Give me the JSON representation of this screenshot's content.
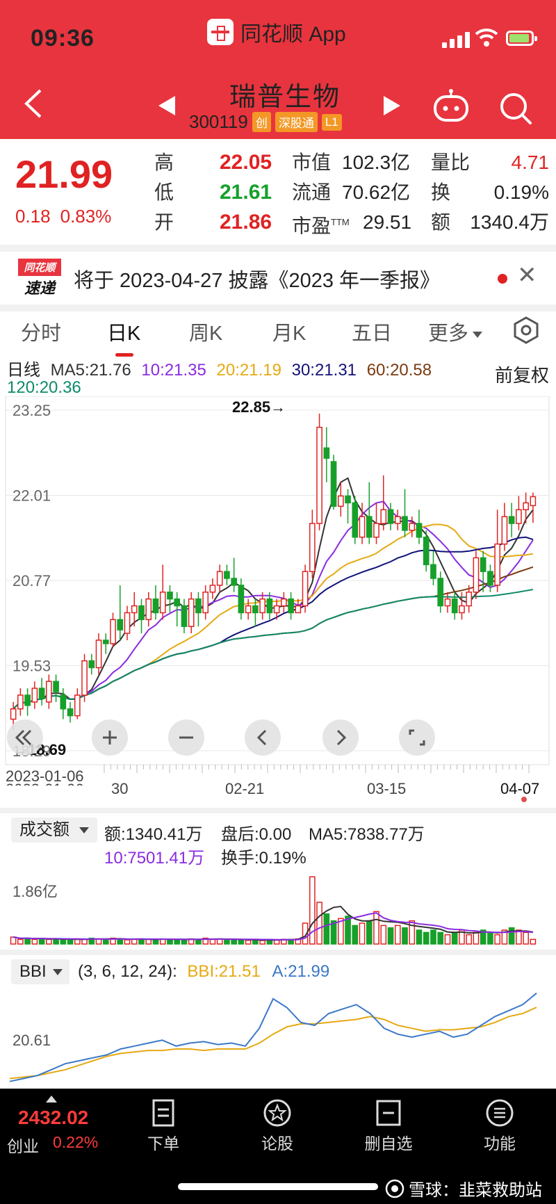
{
  "status_bar": {
    "time": "09:36",
    "app_name": "同花顺 App"
  },
  "header": {
    "stock_name": "瑞普生物",
    "stock_code": "300119",
    "tags": [
      "创",
      "深股通",
      "L1"
    ]
  },
  "quote": {
    "price": "21.99",
    "change": "0.18",
    "change_pct": "0.83%",
    "rows": [
      {
        "l1": "高",
        "v1": "22.05",
        "l2": "市值",
        "v2": "102.3亿",
        "l3": "量比",
        "v3": "4.71"
      },
      {
        "l1": "低",
        "v1": "21.61",
        "l2": "流通",
        "v2": "70.62亿",
        "l3": "换",
        "v3": "0.19%"
      },
      {
        "l1": "开",
        "v1": "21.86",
        "l2": "市盈",
        "l2_sup": "TTM",
        "v2": "29.51",
        "l3": "额",
        "v3": "1340.4万"
      }
    ]
  },
  "notice": {
    "logo_top": "同花顺",
    "logo_bottom": "速递",
    "text": "将于 2023-04-27 披露《2023 年一季报》"
  },
  "tabs": [
    "分时",
    "日K",
    "周K",
    "月K",
    "五日",
    "更多"
  ],
  "ma_legend": {
    "label": "日线",
    "ma5": "MA5:21.76",
    "ma10": "10:21.35",
    "ma20": "20:21.19",
    "ma30": "30:21.31",
    "ma60": "60:20.58",
    "ma120": "120:20.36",
    "adjust": "前复权"
  },
  "kchart": {
    "y_ticks": [
      "23.25",
      "22.01",
      "20.77",
      "19.53",
      "18.29"
    ],
    "high_mark": "22.85→",
    "low_mark": "←18.69",
    "x_labels": [
      "2023-01-06",
      "30",
      "02-21",
      "03-15",
      "04-07"
    ]
  },
  "volume": {
    "indicator": "成交额",
    "amount": "额:1340.41万",
    "after": "盘后:0.00",
    "ma5": "MA5:7838.77万",
    "ma10": "10:7501.41万",
    "turnover": "换手:0.19%",
    "y_tick": "1.86亿"
  },
  "bbi": {
    "indicator": "BBI",
    "params": "(3, 6, 12, 24):",
    "bbi_val": "BBI:21.51",
    "a_val": "A:21.99",
    "y_tick": "20.61"
  },
  "bottom_nav": {
    "index_value": "2432.02",
    "index_name": "创业",
    "index_change": "0.22%",
    "items": [
      "下单",
      "论股",
      "删自选",
      "功能"
    ]
  },
  "watermark": "雪球：韭菜救助站",
  "colors": {
    "header_red": "#e8343e",
    "up": "#e02222",
    "down": "#16a02a",
    "ma5": "#333333",
    "ma10": "#8a2be2",
    "ma20": "#e5a912",
    "ma30": "#12127a",
    "ma60": "#7b3a10",
    "ma120": "#0f8a6a",
    "bbi": "#e5a912",
    "bbi_a": "#3b78c8"
  },
  "chart_data": {
    "type": "candlestick",
    "ylim": [
      18.29,
      23.25
    ],
    "candles": [
      [
        18.75,
        18.9,
        18.6,
        19.0
      ],
      [
        18.9,
        19.1,
        18.8,
        19.2
      ],
      [
        19.1,
        18.95,
        18.8,
        19.2
      ],
      [
        19.0,
        19.2,
        18.9,
        19.3
      ],
      [
        19.2,
        19.05,
        18.95,
        19.35
      ],
      [
        19.0,
        19.3,
        18.9,
        19.4
      ],
      [
        19.3,
        19.15,
        19.0,
        19.4
      ],
      [
        19.1,
        18.9,
        18.75,
        19.2
      ],
      [
        18.9,
        18.8,
        18.7,
        19.0
      ],
      [
        18.8,
        19.1,
        18.75,
        19.2
      ],
      [
        19.1,
        19.6,
        19.0,
        19.7
      ],
      [
        19.6,
        19.5,
        19.4,
        19.7
      ],
      [
        19.5,
        19.9,
        19.4,
        20.0
      ],
      [
        19.9,
        19.85,
        19.7,
        20.0
      ],
      [
        19.85,
        20.2,
        19.8,
        20.3
      ],
      [
        20.2,
        20.05,
        19.9,
        20.7
      ],
      [
        20.0,
        20.3,
        19.9,
        20.4
      ],
      [
        20.3,
        20.4,
        20.1,
        20.6
      ],
      [
        20.4,
        20.2,
        20.0,
        20.5
      ],
      [
        20.2,
        20.5,
        20.1,
        20.6
      ],
      [
        20.5,
        20.3,
        20.2,
        20.7
      ],
      [
        20.3,
        20.6,
        20.2,
        21.0
      ],
      [
        20.6,
        20.5,
        20.3,
        20.7
      ],
      [
        20.5,
        20.4,
        20.1,
        20.6
      ],
      [
        20.4,
        20.1,
        20.0,
        20.5
      ],
      [
        20.1,
        20.5,
        20.0,
        20.6
      ],
      [
        20.5,
        20.3,
        20.1,
        20.6
      ],
      [
        20.3,
        20.6,
        20.2,
        20.7
      ],
      [
        20.6,
        20.7,
        20.5,
        20.8
      ],
      [
        20.7,
        20.9,
        20.6,
        21.0
      ],
      [
        20.9,
        20.8,
        20.7,
        21.0
      ],
      [
        20.8,
        20.7,
        20.6,
        21.1
      ],
      [
        20.7,
        20.3,
        20.2,
        20.8
      ],
      [
        20.3,
        20.4,
        20.2,
        20.5
      ],
      [
        20.4,
        20.3,
        20.1,
        20.5
      ],
      [
        20.3,
        20.5,
        20.2,
        20.6
      ],
      [
        20.5,
        20.3,
        20.2,
        20.6
      ],
      [
        20.3,
        20.4,
        20.2,
        20.5
      ],
      [
        20.4,
        20.5,
        20.3,
        20.6
      ],
      [
        20.5,
        20.3,
        20.2,
        20.6
      ],
      [
        20.3,
        20.4,
        20.3,
        20.5
      ],
      [
        20.4,
        20.9,
        20.3,
        21.0
      ],
      [
        20.9,
        21.6,
        20.8,
        21.8
      ],
      [
        21.6,
        23.0,
        21.5,
        23.2
      ],
      [
        22.7,
        22.55,
        22.2,
        23.0
      ],
      [
        22.5,
        21.85,
        21.8,
        22.6
      ],
      [
        21.85,
        22.0,
        21.7,
        22.2
      ],
      [
        22.0,
        21.9,
        21.6,
        22.1
      ],
      [
        21.9,
        21.4,
        21.3,
        22.0
      ],
      [
        21.4,
        21.7,
        21.3,
        21.9
      ],
      [
        21.7,
        21.4,
        21.3,
        22.2
      ],
      [
        21.4,
        21.6,
        21.3,
        21.9
      ],
      [
        21.6,
        21.8,
        21.5,
        22.3
      ],
      [
        21.8,
        21.6,
        21.5,
        21.9
      ],
      [
        21.6,
        21.7,
        21.5,
        21.8
      ],
      [
        21.7,
        21.5,
        21.4,
        22.1
      ],
      [
        21.5,
        21.6,
        21.4,
        21.7
      ],
      [
        21.6,
        21.4,
        21.3,
        21.8
      ],
      [
        21.4,
        21.0,
        20.9,
        21.5
      ],
      [
        21.0,
        20.8,
        20.7,
        21.2
      ],
      [
        20.8,
        20.4,
        20.3,
        20.9
      ],
      [
        20.4,
        20.5,
        20.3,
        20.6
      ],
      [
        20.5,
        20.3,
        20.2,
        20.6
      ],
      [
        20.3,
        20.4,
        20.2,
        20.6
      ],
      [
        20.4,
        20.6,
        20.3,
        20.7
      ],
      [
        20.6,
        21.1,
        20.5,
        21.2
      ],
      [
        21.1,
        20.9,
        20.6,
        21.2
      ],
      [
        20.9,
        20.7,
        20.6,
        21.0
      ],
      [
        20.7,
        21.3,
        20.6,
        21.8
      ],
      [
        21.3,
        21.7,
        21.2,
        21.9
      ],
      [
        21.7,
        21.6,
        21.4,
        21.9
      ],
      [
        21.6,
        21.8,
        21.5,
        22.0
      ],
      [
        21.8,
        21.9,
        21.6,
        22.05
      ],
      [
        21.86,
        21.99,
        21.61,
        22.05
      ]
    ],
    "volume": [
      0.3,
      0.2,
      0.25,
      0.2,
      0.25,
      0.2,
      0.22,
      0.18,
      0.2,
      0.22,
      0.2,
      0.25,
      0.22,
      0.2,
      0.25,
      0.22,
      0.18,
      0.2,
      0.22,
      0.2,
      0.2,
      0.22,
      0.2,
      0.18,
      0.2,
      0.22,
      0.2,
      0.25,
      0.2,
      0.22,
      0.2,
      0.18,
      0.2,
      0.16,
      0.18,
      0.15,
      0.2,
      0.18,
      0.2,
      0.2,
      0.22,
      0.9,
      2.9,
      1.8,
      1.3,
      1.0,
      1.1,
      1.2,
      0.8,
      0.9,
      1.0,
      1.4,
      0.8,
      0.7,
      0.8,
      0.7,
      1.0,
      0.6,
      0.5,
      0.6,
      0.5,
      0.4,
      0.5,
      0.6,
      0.4,
      0.5,
      0.6,
      0.5,
      0.4,
      0.6,
      0.7,
      0.6,
      0.5,
      0.2
    ],
    "bbi_series": [
      19.1,
      19.15,
      19.2,
      19.3,
      19.4,
      19.55,
      19.7,
      19.85,
      19.95,
      20.0,
      20.05,
      20.05,
      20.1,
      20.1,
      20.05,
      20.1,
      20.1,
      20.1,
      20.3,
      20.6,
      20.85,
      20.95,
      20.95,
      21.0,
      21.05,
      21.1,
      21.2,
      21.1,
      20.9,
      20.8,
      20.7,
      20.75,
      20.75,
      20.8,
      20.85,
      21.0,
      21.2,
      21.3,
      21.51
    ],
    "a_series": [
      19.0,
      19.1,
      19.2,
      19.4,
      19.6,
      19.7,
      19.8,
      19.9,
      20.1,
      20.2,
      20.3,
      20.4,
      20.2,
      20.3,
      20.35,
      20.25,
      20.3,
      20.2,
      20.8,
      21.8,
      21.5,
      21.0,
      20.9,
      21.3,
      21.45,
      21.6,
      21.3,
      20.8,
      20.6,
      20.5,
      20.6,
      20.7,
      20.5,
      20.6,
      20.9,
      21.2,
      21.4,
      21.6,
      21.99
    ]
  }
}
